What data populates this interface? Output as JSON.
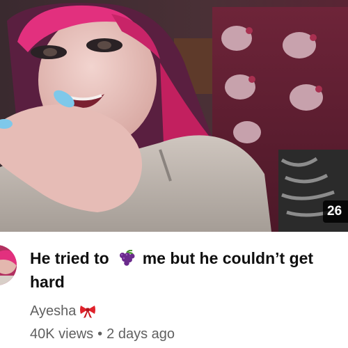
{
  "video": {
    "duration": "26",
    "title_part1": "He tried to",
    "title_emoji_icon": "grapes-icon",
    "title_part2": "me but he couldn’t get hard",
    "channel_name": "Ayesha",
    "channel_badge_icon": "ribbon-bow-icon",
    "views": "40K views",
    "separator": "•",
    "age": "2 days ago"
  },
  "colors": {
    "title_text": "#0f0f0f",
    "meta_text": "#606060",
    "badge_bg": "#000000",
    "grape": "#6a2a8c",
    "bow": "#e0222b"
  }
}
